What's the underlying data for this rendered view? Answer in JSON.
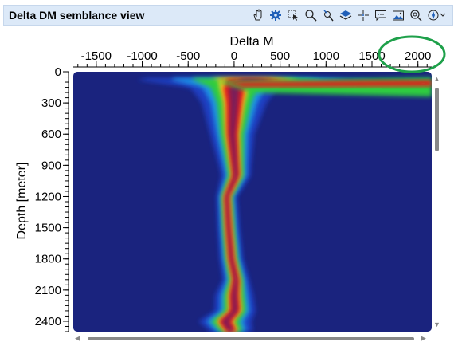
{
  "window": {
    "title": "Delta DM semblance view",
    "toolbar_icons": [
      "pan-hand-icon",
      "settings-gear-icon",
      "select-region-icon",
      "zoom-icon",
      "pick-icon",
      "layers-icon",
      "crosshair-icon",
      "comment-icon",
      "picture-icon",
      "zoom-reset-icon",
      "compass-menu-icon"
    ]
  },
  "chart_data": {
    "type": "heatmap",
    "xlabel": "Delta M",
    "ylabel": "Depth [meter]",
    "x_ticks": [
      -1500,
      -1000,
      -500,
      0,
      500,
      1000,
      1500,
      2000
    ],
    "x_tick_labels": [
      "-1500",
      "-1000",
      "-500",
      "0",
      "500",
      "1000",
      "1500",
      "2000"
    ],
    "y_ticks": [
      0,
      300,
      600,
      900,
      1200,
      1500,
      1800,
      2100,
      2400
    ],
    "y_tick_labels": [
      "0",
      "300",
      "600",
      "900",
      "1200",
      "1500",
      "1800",
      "2100",
      "2400"
    ],
    "xlim": [
      -1750,
      2150
    ],
    "ylim": [
      0,
      2500
    ],
    "colormap": [
      "#1a237e",
      "#1e40c8",
      "#1e8fe6",
      "#2ecc40",
      "#ffd21e",
      "#e41a1a",
      "#7a1a5a"
    ],
    "semblance_trace": [
      {
        "depth": 40,
        "center": -350,
        "width": 120
      },
      {
        "depth": 70,
        "center": 300,
        "width": 900
      },
      {
        "depth": 150,
        "center": 0,
        "width": 300
      },
      {
        "depth": 300,
        "center": 0,
        "width": 220
      },
      {
        "depth": 600,
        "center": -20,
        "width": 150
      },
      {
        "depth": 900,
        "center": 10,
        "width": 110
      },
      {
        "depth": 1000,
        "center": 20,
        "width": 100
      },
      {
        "depth": 1200,
        "center": -80,
        "width": 70
      },
      {
        "depth": 1500,
        "center": -60,
        "width": 75
      },
      {
        "depth": 1800,
        "center": -30,
        "width": 80
      },
      {
        "depth": 2000,
        "center": 20,
        "width": 90
      },
      {
        "depth": 2150,
        "center": 0,
        "width": 130
      },
      {
        "depth": 2300,
        "center": 10,
        "width": 140
      },
      {
        "depth": 2400,
        "center": -100,
        "width": 180
      },
      {
        "depth": 2480,
        "center": -40,
        "width": 150
      }
    ]
  }
}
